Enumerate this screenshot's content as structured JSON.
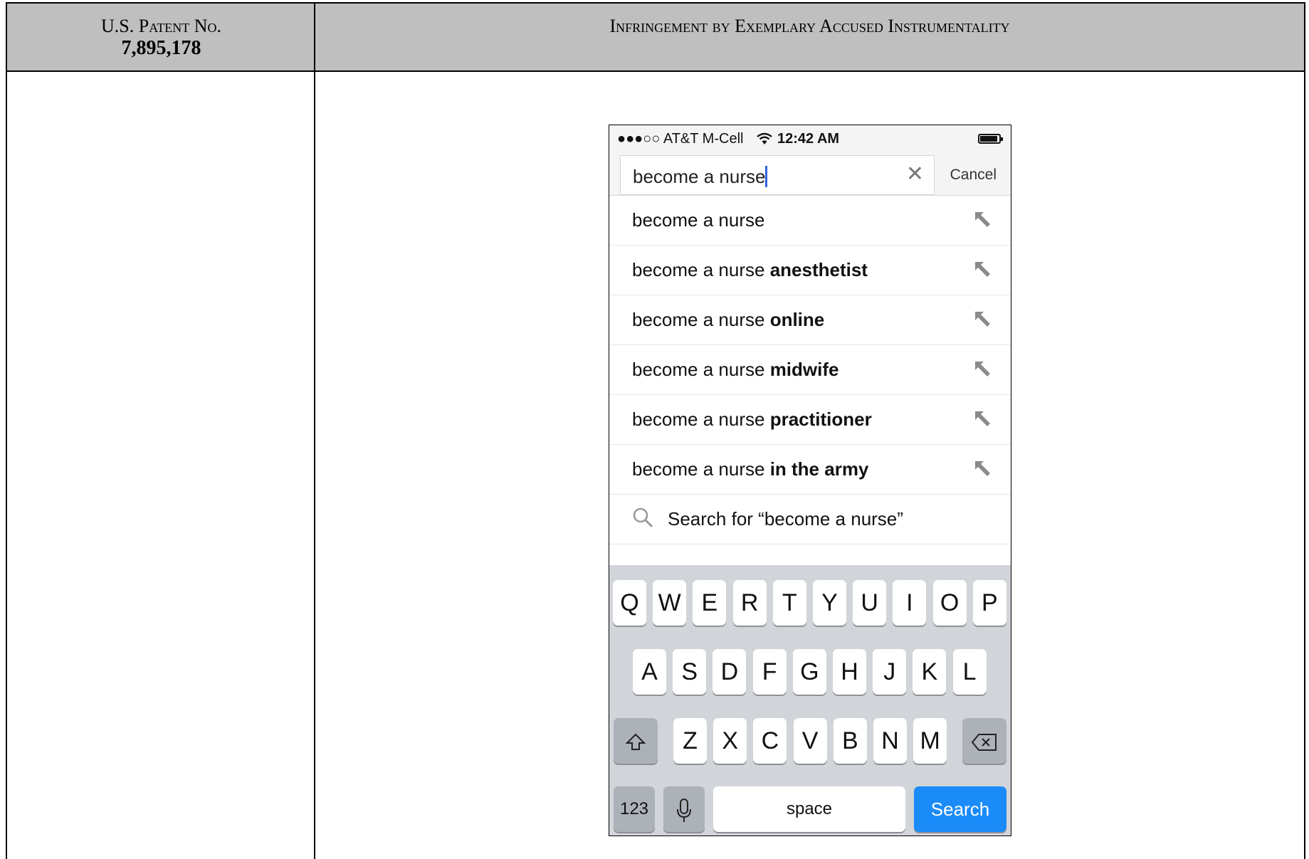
{
  "header": {
    "left_line1": "U.S. Patent No.",
    "left_line2": "7,895,178",
    "right": "Infringement by Exemplary Accused Instrumentality"
  },
  "screenshot": {
    "status_bar": {
      "carrier": "●●●○○ AT&T M-Cell",
      "time": "12:42 AM"
    },
    "search": {
      "value": "become a nurse",
      "cancel_label": "Cancel"
    },
    "suggestions": [
      {
        "base": "become a nurse",
        "completion": ""
      },
      {
        "base": "become a nurse",
        "completion": "anesthetist"
      },
      {
        "base": "become a nurse",
        "completion": "online"
      },
      {
        "base": "become a nurse",
        "completion": "midwife"
      },
      {
        "base": "become a nurse",
        "completion": "practitioner"
      },
      {
        "base": "become a nurse",
        "completion": "in the army"
      }
    ],
    "search_for": "Search for “become a nurse”",
    "keyboard": {
      "row1": [
        "Q",
        "W",
        "E",
        "R",
        "T",
        "Y",
        "U",
        "I",
        "O",
        "P"
      ],
      "row2": [
        "A",
        "S",
        "D",
        "F",
        "G",
        "H",
        "J",
        "K",
        "L"
      ],
      "row3": [
        "Z",
        "X",
        "C",
        "V",
        "B",
        "N",
        "M"
      ],
      "numbers_label": "123",
      "space_label": "space",
      "search_label": "Search"
    },
    "icons": [
      "wifi-icon",
      "battery-icon",
      "clear-icon",
      "fill-arrow-icon",
      "search-icon",
      "shift-icon",
      "backspace-icon",
      "microphone-icon"
    ],
    "colors": {
      "caret": "#2f64d8",
      "search_key": "#1a8bf8",
      "header_bg": "#bfbfbf"
    }
  }
}
